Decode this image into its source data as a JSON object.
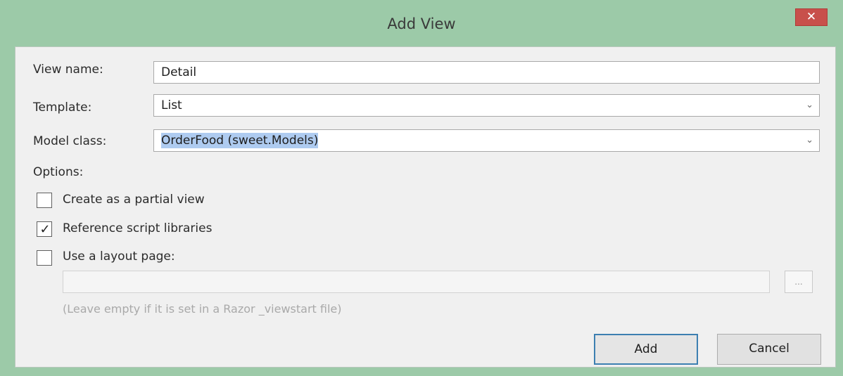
{
  "window": {
    "title": "Add View",
    "close_glyph": "✕"
  },
  "form": {
    "view_name_label": "View name:",
    "view_name_value": "Detail",
    "template_label": "Template:",
    "template_value": "List",
    "model_class_label": "Model class:",
    "model_class_value": "OrderFood (sweet.Models)",
    "dropdown_glyph": "⌄"
  },
  "options": {
    "heading": "Options:",
    "partial_view": {
      "label": "Create as a partial view",
      "checked": false
    },
    "reference_scripts": {
      "label": "Reference script libraries",
      "checked": true
    },
    "use_layout": {
      "label": "Use a layout page:",
      "checked": false
    },
    "layout_path_value": "",
    "browse_label": "...",
    "hint": "(Leave empty if it is set in a Razor _viewstart file)",
    "check_glyph": "✓"
  },
  "buttons": {
    "add": "Add",
    "cancel": "Cancel"
  },
  "colors": {
    "title_bar": "#9ccaa8",
    "close_button": "#c8504b",
    "selection": "#aecbf0",
    "default_button_border": "#3c7fb1"
  },
  "icons": {
    "close": "close-icon",
    "dropdown": "chevron-down-icon",
    "check": "check-icon"
  }
}
